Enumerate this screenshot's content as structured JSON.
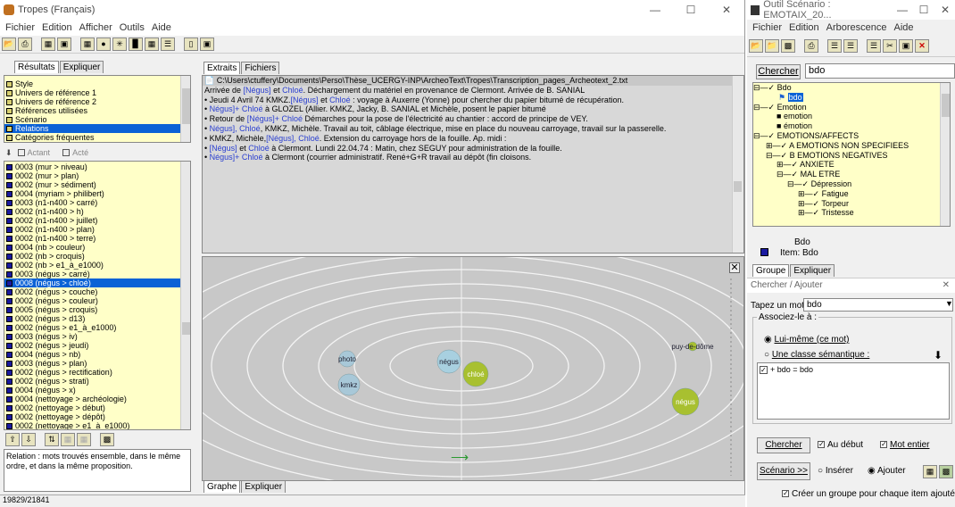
{
  "tropes": {
    "title": "Tropes (Français)",
    "menu": [
      "Fichier",
      "Edition",
      "Afficher",
      "Outils",
      "Aide"
    ],
    "left_tabs": [
      "Résultats",
      "Expliquer"
    ],
    "categories": [
      "Style",
      "Univers de référence 1",
      "Univers de référence 2",
      "Références utilisées",
      "Scénario",
      "Relations",
      "Catégories fréquentes"
    ],
    "actant_label": "Actant",
    "acte_label": "Acté",
    "relations": [
      "0003 (mur > niveau)",
      "0002 (mur > plan)",
      "0002 (mur > sédiment)",
      "0004 (myriam > philibert)",
      "0003 (n1-n400 > carré)",
      "0002 (n1-n400 > h)",
      "0002 (n1-n400 > juillet)",
      "0002 (n1-n400 > plan)",
      "0002 (n1-n400 > terre)",
      "0004 (nb > couleur)",
      "0002 (nb > croquis)",
      "0002 (nb > e1_à_e1000)",
      "0003 (négus > carré)",
      "0008 (négus > chloé)",
      "0002 (négus > couche)",
      "0002 (négus > couleur)",
      "0005 (négus > croquis)",
      "0002 (négus > d13)",
      "0002 (négus > e1_à_e1000)",
      "0003 (négus > iv)",
      "0002 (négus > jeudi)",
      "0004 (négus > nb)",
      "0003 (négus > plan)",
      "0002 (négus > rectification)",
      "0002 (négus > strati)",
      "0004 (négus > x)",
      "0004 (nettoyage > archéologie)",
      "0002 (nettoyage > début)",
      "0002 (nettoyage > dépôt)",
      "0002 (nettoyage > e1_à_e1000)"
    ],
    "relation_description": "Relation : mots trouvés ensemble, dans le même ordre, et dans la même proposition.",
    "status": "19829/21841",
    "extract_tabs": [
      "Extraits",
      "Fichiers"
    ],
    "file_path": "C:\\Users\\ctuffery\\Documents\\Perso\\Thèse_UCERGY-INP\\ArcheoText\\Tropes\\Transcription_pages_Archeotext_2.txt",
    "extracts": [
      [
        {
          "t": "Arrivée de "
        },
        {
          "t": "[Négus]",
          "b": true
        },
        {
          "t": " et "
        },
        {
          "t": "Chloé",
          "b": true
        },
        {
          "t": ". Déchargement du matériel en provenance de Clermont. Arrivée de B. SANIAL"
        }
      ],
      [
        {
          "t": "• Jeudi 4 Avril 74 KMKZ."
        },
        {
          "t": "[Négus]",
          "b": true
        },
        {
          "t": " et "
        },
        {
          "t": "Chloé",
          "b": true
        },
        {
          "t": " : voyage à Auxerre (Yonne) pour chercher du papier bitumé de récupération."
        }
      ],
      [
        {
          "t": "• "
        },
        {
          "t": "Négus]+ Chloé",
          "b": true
        },
        {
          "t": " à GLOZEL (Allier. KMKZ, Jacky, B. SANIAL et Michèle, posent le papier bitumé"
        }
      ],
      [
        {
          "t": "• Retour de "
        },
        {
          "t": "[Négus]+ Chloé",
          "b": true
        },
        {
          "t": " Démarches pour la pose de l'électricité au chantier : accord de principe de VEY."
        }
      ],
      [
        {
          "t": "• "
        },
        {
          "t": "Négus], Chloé",
          "b": true
        },
        {
          "t": ", KMKZ, Michèle. Travail au toit, câblage électrique, mise en place du nouveau carroyage, travail sur la passerelle."
        }
      ],
      [
        {
          "t": "• KMKZ, Michèle,"
        },
        {
          "t": "[Négus], Chloé",
          "b": true
        },
        {
          "t": ". Extension du carroyage hors de la fouille. Ap. midi :"
        }
      ],
      [
        {
          "t": "• "
        },
        {
          "t": "[Négus]",
          "b": true
        },
        {
          "t": " et "
        },
        {
          "t": "Chloé",
          "b": true
        },
        {
          "t": " à Clermont. Lundi 22.04.74 : Matin, chez SEGUY pour administration de la fouille."
        }
      ],
      [
        {
          "t": "• "
        },
        {
          "t": "Négus]+ Chloé",
          "b": true
        },
        {
          "t": " à Clermont (courrier administratif. René+G+R travail au dépôt (fin cloisons."
        }
      ]
    ],
    "graph_tabs": [
      "Graphe",
      "Expliquer"
    ],
    "nodes": [
      {
        "label": "photo",
        "color": "#a8c8d8"
      },
      {
        "label": "kmkz",
        "color": "#a8c8d8"
      },
      {
        "label": "négus",
        "color": "#a8d0e0"
      },
      {
        "label": "chloé",
        "color": "#a8c030"
      },
      {
        "label": "puy-de-dôme",
        "color": "#a8c030"
      },
      {
        "label": "négus",
        "color": "#a8c030"
      }
    ]
  },
  "scenario": {
    "title": "Outil Scénario : EMOTAIX_20...",
    "menu": [
      "Fichier",
      "Edition",
      "Arborescence",
      "Aide"
    ],
    "search_button": "Chercher",
    "search_value": "bdo",
    "tree": [
      "Bdo",
      "bdo",
      "Emotion",
      "emotion",
      "émotion",
      "EMOTIONS/AFFECTS",
      "A EMOTIONS NON SPECIFIEES",
      "B EMOTIONS NEGATIVES",
      "ANXIETE",
      "MAL ETRE",
      "Dépression",
      "Fatigue",
      "Torpeur",
      "Tristesse"
    ],
    "selected_label": "Bdo",
    "item_label": "Item: Bdo",
    "tabs": [
      "Groupe",
      "Expliquer"
    ],
    "panel_title": "Chercher / Ajouter",
    "type_label": "Tapez un mot :",
    "type_value": "bdo",
    "associate_label": "Associez-le à :",
    "radio_self": "Lui-même (ce mot)",
    "radio_class": "Une classe sémantique :",
    "assoc_item": "+ bdo = bdo",
    "chercher": "Chercher",
    "au_debut": "Au début",
    "mot_entier": "Mot entier",
    "scenario_btn": "Scénario >>",
    "inserer": "Insérer",
    "ajouter": "Ajouter",
    "create_group": "Créer un groupe pour chaque item ajouté"
  }
}
